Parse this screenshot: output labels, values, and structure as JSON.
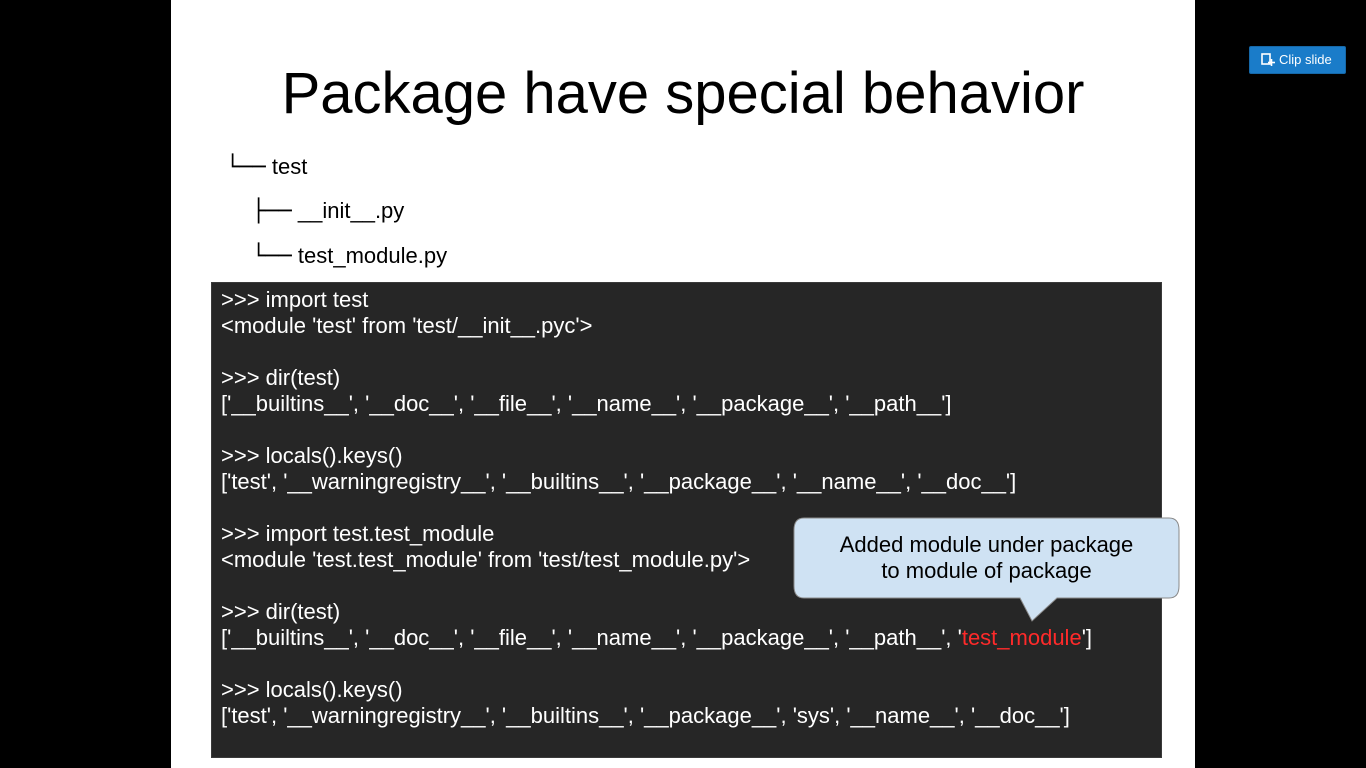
{
  "slide": {
    "title": "Package have special behavior",
    "tree": [
      {
        "glyph": "└──",
        "label": "test"
      },
      {
        "glyph": "├──",
        "label": "__init__.py"
      },
      {
        "glyph": "└──",
        "label": "test_module.py"
      }
    ],
    "code": {
      "line1": ">>> import test",
      "line2": "<module 'test' from 'test/__init__.pyc'>",
      "line3": ">>> dir(test)",
      "line4": "['__builtins__', '__doc__', '__file__', '__name__', '__package__', '__path__']",
      "line5": ">>> locals().keys()",
      "line6": "['test', '__warningregistry__', '__builtins__', '__package__', '__name__', '__doc__']",
      "line7": ">>> import test.test_module",
      "line8": "<module 'test.test_module' from 'test/test_module.py'>",
      "line9": ">>> dir(test)",
      "line10_prefix": "['__builtins__', '__doc__', '__file__', '__name__', '__package__', '__path__', '",
      "line10_highlight": "test_module",
      "line10_suffix": "']",
      "line11": ">>> locals().keys()",
      "line12": "['test', '__warningregistry__', '__builtins__', '__package__', 'sys', '__name__', '__doc__']"
    },
    "callout": {
      "line1": "Added module under package",
      "line2": "to module of package"
    }
  },
  "toolbar": {
    "clip_label": "Clip slide",
    "clip_icon": "clip-slide-icon"
  },
  "colors": {
    "background": "#000000",
    "slide": "#ffffff",
    "code_panel": "#262626",
    "highlight": "#ff2a2a",
    "callout_fill": "#cfe2f3",
    "button": "#1a7cc9"
  }
}
